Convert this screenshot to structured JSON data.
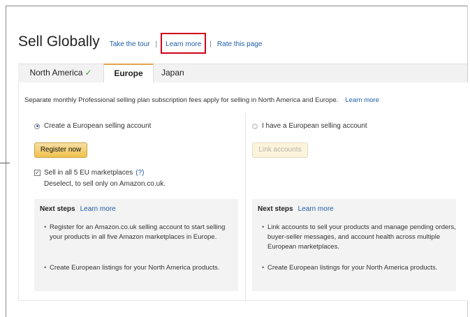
{
  "header": {
    "title": "Sell Globally",
    "links": [
      "Take the tour",
      "Learn more",
      "Rate this page"
    ],
    "separator": "|"
  },
  "tabs": [
    {
      "label": "North America",
      "check": "✓"
    },
    {
      "label": "Europe"
    },
    {
      "label": "Japan"
    }
  ],
  "notice": {
    "text": "Separate monthly Professional selling plan subscription fees apply for selling in North America and Europe.",
    "link": "Learn more"
  },
  "left": {
    "radio_label": "Create a European selling account",
    "button": "Register now",
    "checkbox_label": "Sell in all 5 EU marketplaces",
    "help": "(?)",
    "deselect": "Deselect, to sell only on Amazon.co.uk.",
    "steps_title": "Next steps",
    "steps_link": "Learn more",
    "steps": [
      "Register for an Amazon.co.uk selling account to start selling your products in all five Amazon marketplaces in Europe.",
      "Create European listings for your North America products."
    ]
  },
  "right": {
    "radio_label": "I have a European selling account",
    "button": "Link accounts",
    "steps_title": "Next steps",
    "steps_link": "Learn more",
    "steps": [
      "Link accounts to sell your products and manage pending orders, buyer-seller messages, and account health across multiple European marketplaces.",
      "Create European listings for your North America products."
    ]
  },
  "colors": {
    "accent_tab": "#e3a34b",
    "link": "#1f5ea8",
    "highlight_box": "#d0021b",
    "primary_button": "#f0c14b"
  }
}
